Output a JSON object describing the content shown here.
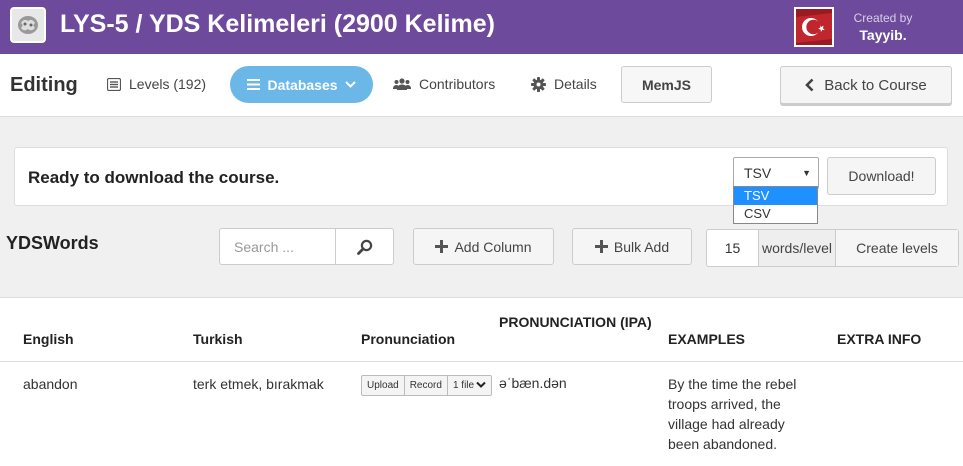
{
  "header": {
    "course_title": "LYS-5 / YDS Kelimeleri (2900 Kelime)",
    "created_by_label": "Created by",
    "creator_name": "Tayyib.",
    "brand_color": "#6d4a9c"
  },
  "nav": {
    "editing_label": "Editing",
    "levels_label": "Levels (192)",
    "databases_label": "Databases",
    "contributors_label": "Contributors",
    "details_label": "Details",
    "memjs_label": "MemJS",
    "back_label": "Back to Course",
    "active_color": "#6bb7e7"
  },
  "download": {
    "message": "Ready to download the course.",
    "selected_format": "TSV",
    "options": [
      "TSV",
      "CSV"
    ],
    "button_label": "Download!"
  },
  "database": {
    "name": "YDSWords",
    "search_placeholder": "Search ...",
    "add_column_label": "Add Column",
    "bulk_add_label": "Bulk Add",
    "words_per_level": "15",
    "words_level_label": "words/level",
    "create_levels_label": "Create levels"
  },
  "table": {
    "columns": {
      "english": "English",
      "turkish": "Turkish",
      "pronunciation": "Pronunciation",
      "pronunciation_ipa": "PRONUNCIATION (IPA)",
      "examples": "EXAMPLES",
      "extra_info": "EXTRA INFO"
    },
    "rows": [
      {
        "english": "abandon",
        "turkish": "terk etmek, bırakmak",
        "audio_upload": "Upload",
        "audio_record": "Record",
        "audio_files": "1 file",
        "ipa": "əˈbæn.dən",
        "example": "By the time the rebel troops arrived, the village had already been abandoned.",
        "extra_info": ""
      }
    ]
  }
}
